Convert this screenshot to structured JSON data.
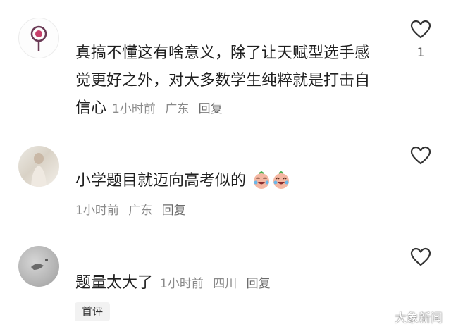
{
  "comments": [
    {
      "text_line1": "真搞不懂这有啥意义，除了让天赋型选手感",
      "text_line2": "觉更好之外，对大多数学生纯粹就是打击自",
      "text_line3": "信心",
      "time": "1小时前",
      "location": "广东",
      "reply": "回复",
      "likes": "1"
    },
    {
      "text": "小学题目就迈向高考似的",
      "time": "1小时前",
      "location": "广东",
      "reply": "回复"
    },
    {
      "text": "题量太大了",
      "time": "1小时前",
      "location": "四川",
      "reply": "回复",
      "tag": "首评"
    }
  ],
  "watermark": "大象新闻",
  "icons": {
    "like": "heart-outline-icon",
    "emoji": "crying-laughing-face-icon"
  }
}
